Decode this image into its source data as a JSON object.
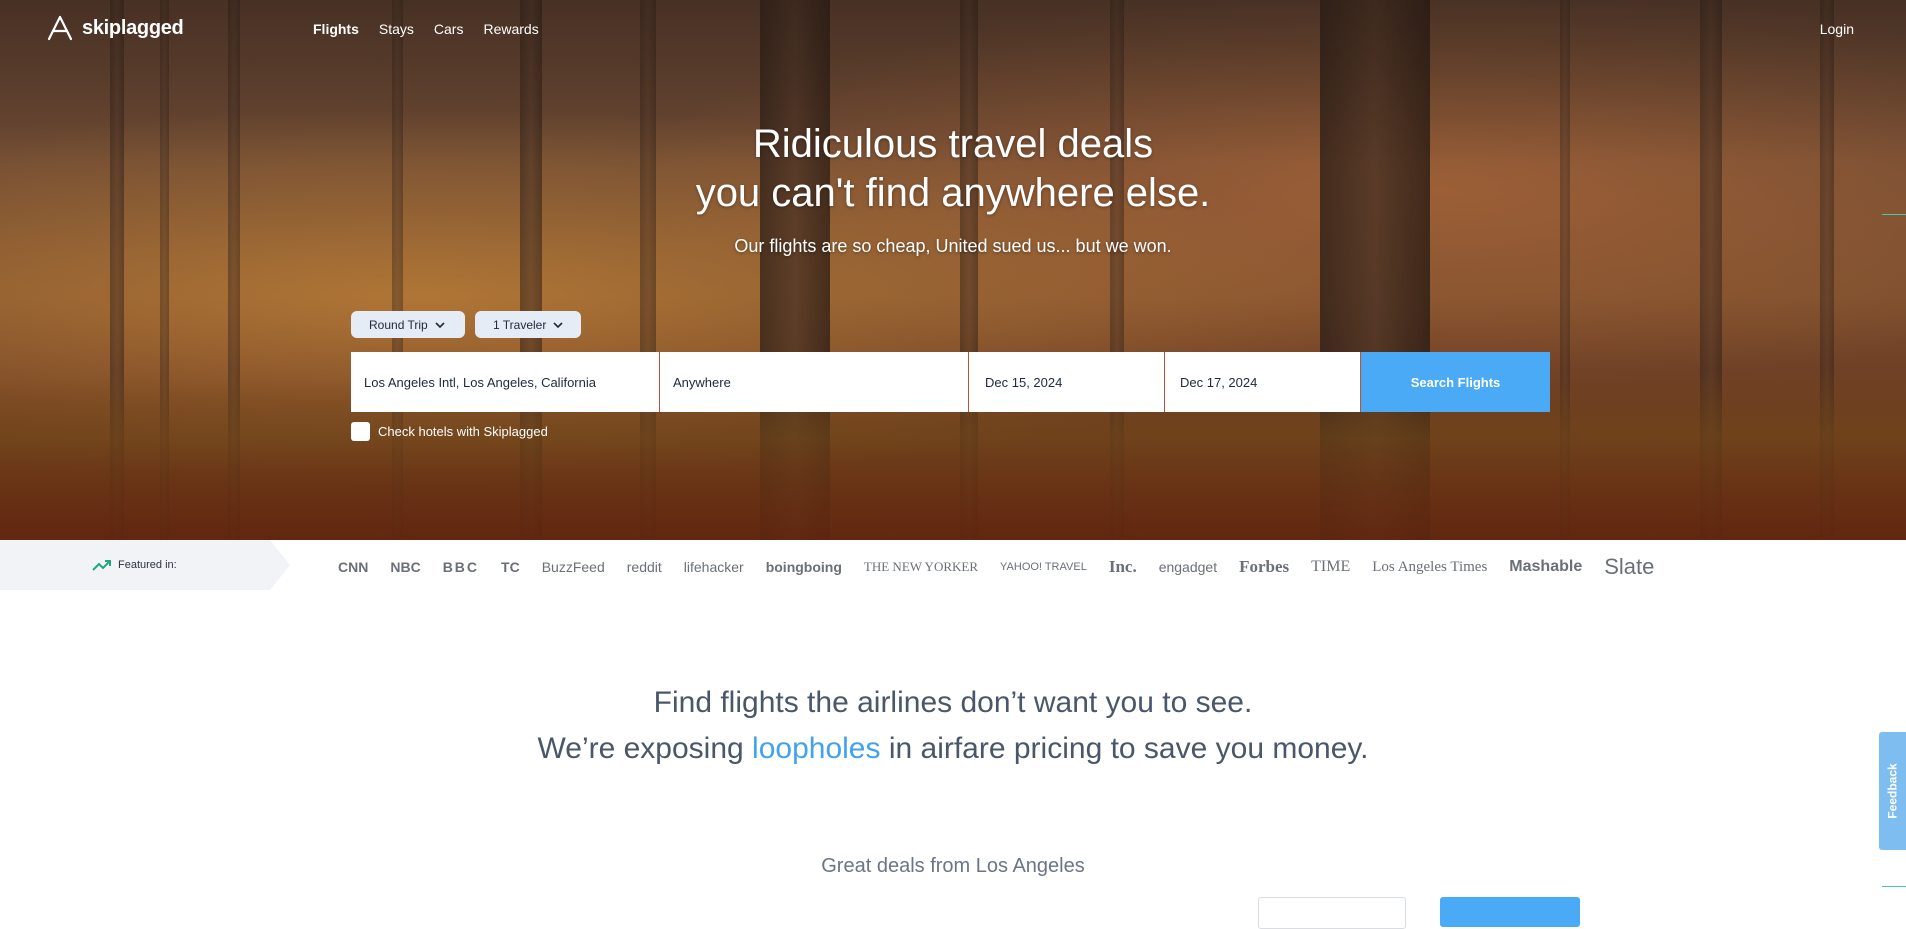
{
  "brand": {
    "name": "skiplagged",
    "logo_icon": "skiplagged-logo-icon"
  },
  "nav": {
    "links": [
      {
        "label": "Flights",
        "active": true
      },
      {
        "label": "Stays",
        "active": false
      },
      {
        "label": "Cars",
        "active": false
      },
      {
        "label": "Rewards",
        "active": false
      }
    ],
    "login": "Login"
  },
  "hero": {
    "headline_line1": "Ridiculous travel deals",
    "headline_line2": "you can't find anywhere else.",
    "subheadline": "Our flights are so cheap, United sued us... but we won."
  },
  "search": {
    "trip_type": "Round Trip",
    "travelers": "1 Traveler",
    "origin": "Los Angeles Intl, Los Angeles, California",
    "destination": "Anywhere",
    "depart_date": "Dec 15, 2024",
    "return_date": "Dec 17, 2024",
    "submit_label": "Search Flights",
    "hotel_checkbox_label": "Check hotels with Skiplagged",
    "hotel_checked": false
  },
  "featured": {
    "label": "Featured in:",
    "outlets": [
      "CNN",
      "NBC",
      "BBC",
      "TC",
      "BuzzFeed",
      "reddit",
      "lifehacker",
      "boingboing",
      "THE NEW YORKER",
      "YAHOO! TRAVEL",
      "Inc.",
      "engadget",
      "Forbes",
      "TIME",
      "Los Angeles Times",
      "Mashable",
      "Slate"
    ]
  },
  "promo": {
    "line1": "Find flights the airlines don’t want you to see.",
    "line2_prefix": "We’re exposing ",
    "line2_accent": "loopholes",
    "line2_suffix": " in airfare pricing to save you money."
  },
  "deals": {
    "heading": "Great deals from Los Angeles"
  },
  "feedback": {
    "label": "Feedback"
  },
  "colors": {
    "accent": "#4aaaf5",
    "promo_accent": "#43a2f0",
    "text_dark": "#4a5769"
  }
}
